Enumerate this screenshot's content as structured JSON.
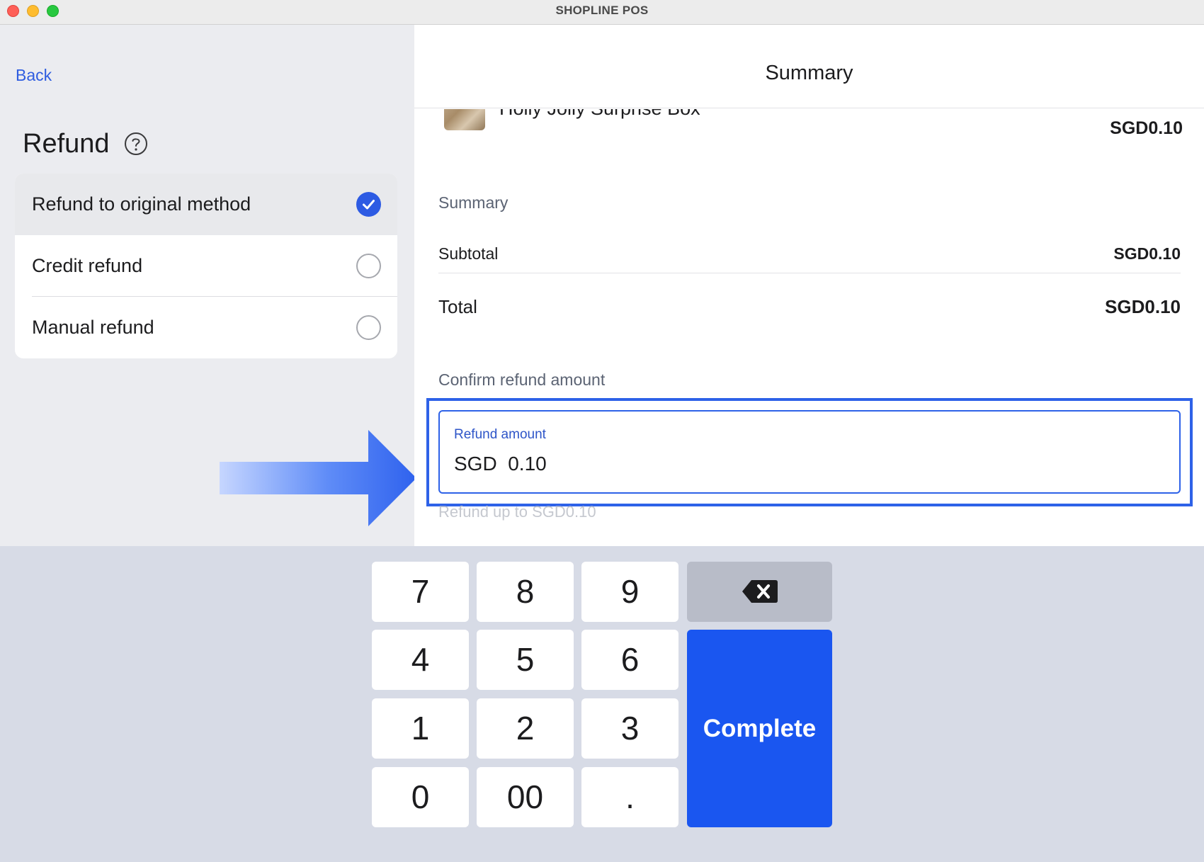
{
  "window": {
    "title": "SHOPLINE POS"
  },
  "left": {
    "back_label": "Back",
    "title": "Refund",
    "options": [
      {
        "label": "Refund to original method",
        "selected": true
      },
      {
        "label": "Credit refund",
        "selected": false
      },
      {
        "label": "Manual refund",
        "selected": false
      }
    ]
  },
  "right": {
    "header_title": "Summary",
    "product": {
      "name": "Holly Jolly Surprise Box",
      "price": "SGD0.10"
    },
    "summary_label": "Summary",
    "subtotal_label": "Subtotal",
    "subtotal_value": "SGD0.10",
    "total_label": "Total",
    "total_value": "SGD0.10",
    "confirm_label": "Confirm refund amount",
    "amount_field": {
      "label": "Refund amount",
      "value": "SGD  0.10"
    },
    "refund_hint": "Refund up to SGD0.10"
  },
  "keypad": {
    "keys": [
      "7",
      "8",
      "9",
      "4",
      "5",
      "6",
      "1",
      "2",
      "3",
      "0",
      "00",
      "."
    ],
    "complete_label": "Complete"
  },
  "colors": {
    "accent": "#1a56f0",
    "link": "#2f5de0",
    "panel_bg": "#ebecf0",
    "keypad_bg": "#d7dbe6"
  }
}
